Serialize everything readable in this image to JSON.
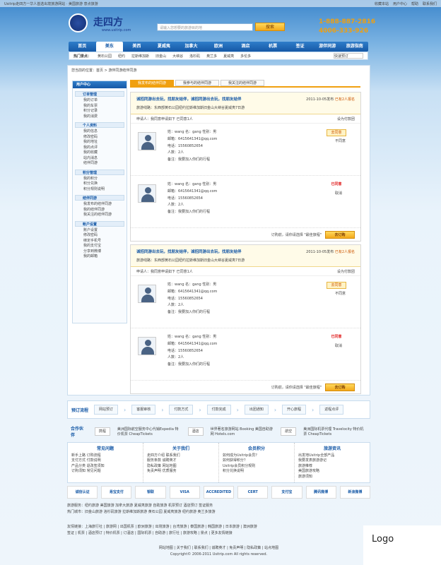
{
  "topbar": {
    "left": "Usitrip走四方一华人首选出境旅游网站 · 美国旅游  意点旅游",
    "links": [
      "收藏本站",
      "用户中心",
      "帮助",
      "联系我们"
    ]
  },
  "logo": {
    "name": "走四方",
    "url": "www.usitrip.com"
  },
  "search": {
    "placeholder": "请输入您想要的旅游目的地",
    "button": "搜索"
  },
  "phones": [
    "1-888-887-2816",
    "4006-333-926"
  ],
  "nav": [
    "首页",
    "美东",
    "美西",
    "夏威夷",
    "加拿大",
    "欧洲",
    "酒店",
    "机票",
    "签证",
    "游伴同游",
    "旅游指南"
  ],
  "subnav": {
    "label": "热门景点：",
    "items": [
      "黄石公园",
      "纽约",
      "拉斯维加斯",
      "旧金山",
      "大峡谷",
      "洛杉矶",
      "奥兰多",
      "夏威夷",
      "多伦多"
    ],
    "quick": "快速预订"
  },
  "breadcrumb": "您当前的位置：首页 > 游伴同游结伴同游",
  "sidebar": {
    "title": "用户中心",
    "groups": [
      {
        "title": "订单管理",
        "items": [
          "我的订单",
          "我的车票",
          "积分记录",
          "我的消费"
        ]
      },
      {
        "title": "个人资料",
        "items": [
          "我的信息",
          "修改密码",
          "我的地址",
          "我的点评",
          "我的收藏",
          "站内消息",
          "结伴同游"
        ]
      },
      {
        "title": "积分管理",
        "items": [
          "我的积分",
          "积分兑换",
          "积分规则说明"
        ]
      },
      {
        "title": "结伴同游",
        "items": [
          "我发布的结伴同游",
          "我的结伴同游",
          "我关注的结伴同游"
        ]
      },
      {
        "title": "帐户设置",
        "items": [
          "账户设置",
          "修改密码",
          "绑定手机号",
          "我的支付宝",
          "分享到微博",
          "我的邮箱"
        ]
      }
    ]
  },
  "tabs": [
    "我发布的结伴同游",
    "我参与的结伴同游",
    "我关注的结伴同游"
  ],
  "orders": [
    {
      "title": "诚招同游出去玩，找朋友结伴，诚招同游出去玩，找朋友结伴",
      "desc": "旅游线路：东西部黄石公园纽约拉斯维加斯旧金山大峡谷夏威夷7日游",
      "date": "2011-10-05发布",
      "status": "已有2人报名",
      "applicants": "申请人：我同意申请如下 已同意1人",
      "set": "设为付款团",
      "foot_note": "订购前，请你请选择 \"最佳旅程\"",
      "order_btn": "去订购",
      "people": [
        {
          "name": "姓：wang  名：gang  性别：男",
          "email": "邮箱：6415641341@qq.com",
          "phone": "电话：15560852654",
          "count": "人数：2人",
          "note": "备注：我要加入你们的行程",
          "badge": "去同意",
          "badge_red": false,
          "badge_note": "不同意"
        },
        {
          "name": "姓：wang  名：gang  性别：男",
          "email": "邮箱：6415641341@qq.com",
          "phone": "电话：15560852654",
          "count": "人数：2人",
          "note": "备注：我要加入你们的行程",
          "badge": "已同意",
          "badge_red": true,
          "badge_note": "取消"
        }
      ]
    },
    {
      "title": "诚招同游出去玩，找朋友结伴，诚招同游出去玩，找朋友结伴",
      "desc": "旅游线路：东西部黄石公园纽约拉斯维加斯旧金山大峡谷夏威夷7日游",
      "date": "2011-10-05发布",
      "status": "已有2人报名",
      "applicants": "申请人：我同意申请如下 已同意1人",
      "set": "设为付款团",
      "foot_note": "订购前，请你请选择 \"最佳旅程\"",
      "order_btn": "去订购",
      "people": [
        {
          "name": "姓：wang  名：gang  性别：男",
          "email": "邮箱：6415641341@qq.com",
          "phone": "电话：15560852654",
          "count": "人数：2人",
          "note": "备注：我要加入你们的行程",
          "badge": "去同意",
          "badge_red": false,
          "badge_note": "不同意"
        },
        {
          "name": "姓：wang  名：gang  性别：男",
          "email": "邮箱：6415641341@qq.com",
          "phone": "电话：15560852654",
          "count": "人数：2人",
          "note": "备注：我要加入你们的行程",
          "badge": "已同意",
          "badge_red": true,
          "badge_note": "取消"
        }
      ]
    }
  ],
  "flow": {
    "label": "预订流程",
    "steps": [
      "网站预订",
      "客服审核",
      "付款方式",
      "付款完成",
      "出团通知",
      "开心旅程",
      "返程点评"
    ]
  },
  "partners": {
    "label": "合作伙伴",
    "items": [
      {
        "logo": "携程",
        "text": "美洲国际航空服务中心代销Expedia 特价机票 CheapTickets"
      },
      {
        "logo": "酒店",
        "text": "世界著名旅游网站 Booking 美国自助游网 Hotels.com"
      },
      {
        "logo": "航空",
        "text": "美洲国际机票代理 Travelocity 特价机票 CheapTickets"
      }
    ]
  },
  "help": [
    {
      "title": "常见问题",
      "items": [
        "新手上路",
        "订购流程",
        "支付方式",
        "付款说明",
        "产品分类",
        "退改签须知",
        "订购须知",
        "常见问题"
      ]
    },
    {
      "title": "关于我们",
      "items": [
        "走四方介绍",
        "联系我们",
        "服务条款",
        "诚聘英才",
        "隐私政策",
        "网站地图",
        "免责声明",
        "优质服务"
      ]
    },
    {
      "title": "会员积分",
      "items": [
        "如何成为Usitrip会员？",
        "如何获得积分？",
        "Usitrip会员积分规则",
        "积分兑换说明"
      ]
    },
    {
      "title": "旅游资讯",
      "items": [
        "出发地Usitrip全部产品",
        "我要发表旅游游记",
        "旅游推荐",
        "美国旅游攻略",
        "旅游须知"
      ]
    }
  ],
  "certs": [
    "诚信认证",
    "易宝支付",
    "银联",
    "VISA",
    "ACCREDITED",
    "CERT",
    "支付宝",
    "腾讯微博",
    "新浪微博"
  ],
  "link_lines": [
    "旅游服务：纽约旅游 美国旅游 加拿大旅游 夏威夷旅游 自助旅游 机票预订 酒店预订 签证服务",
    "热门城市：旧金山旅游 洛杉矶旅游 拉斯维加斯旅游 黄石公园 夏威夷旅游 纽约旅游 奥兰多旅游"
  ],
  "friend_links": [
    "友情链接：上海旅行社 | 旅游网 | 出国机票 | 欧洲旅游 | 出境旅游 | 台湾旅游 | 泰国旅游 | 韩国旅游 | 日本旅游 | 澳洲旅游",
    "签证 | 机票 | 酒店预订 | 特价机票 | 订酒店 | 国际机票 | 自助游 | 旅行社 | 旅游攻略 | 景点 | 更多友情链接"
  ],
  "footer": [
    "网站地图 | 关于我们 | 联系我们 | 诚聘英才 | 免责声明 | 隐私政策 | 站点地图",
    "Copyright© 2006-2011 Usitrip.com All rights reserved."
  ],
  "logobox": "Logo"
}
